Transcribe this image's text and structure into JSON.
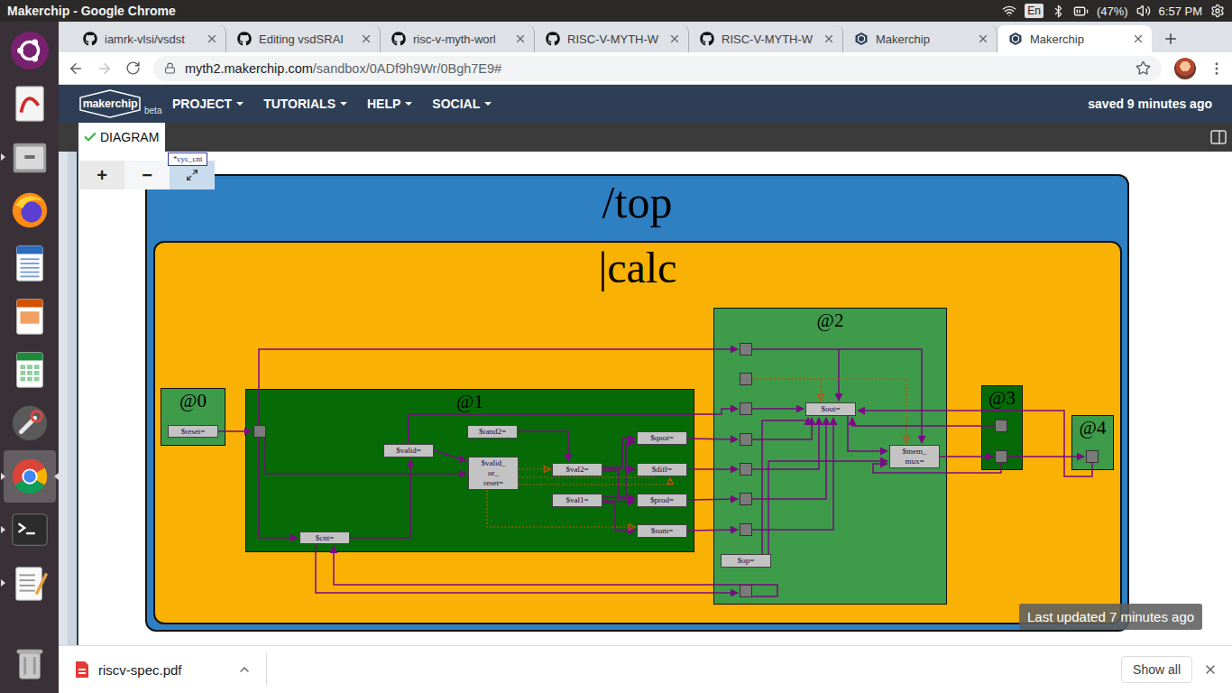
{
  "os_bar": {
    "title": "Makerchip - Google Chrome",
    "language": "En",
    "battery": "(47%)",
    "time": "6:57 PM"
  },
  "dock": [
    {
      "kind": "ubuntu",
      "running": false,
      "focused": false
    },
    {
      "kind": "reader",
      "running": false,
      "focused": false
    },
    {
      "kind": "files",
      "running": true,
      "focused": false
    },
    {
      "kind": "firefox",
      "running": false,
      "focused": false
    },
    {
      "kind": "writer",
      "running": false,
      "focused": false
    },
    {
      "kind": "impress",
      "running": false,
      "focused": false
    },
    {
      "kind": "calc",
      "running": false,
      "focused": false
    },
    {
      "kind": "settings",
      "running": false,
      "focused": false
    },
    {
      "kind": "chrome",
      "running": true,
      "focused": true
    },
    {
      "kind": "terminal",
      "running": true,
      "focused": false
    },
    {
      "kind": "editor",
      "running": true,
      "focused": false
    },
    {
      "kind": "trash",
      "running": false,
      "focused": false
    }
  ],
  "browser": {
    "tabs": [
      {
        "label": "iamrk-vlsi/vsdst",
        "kind": "github",
        "selected": false
      },
      {
        "label": "Editing vsdSRAI",
        "kind": "github",
        "selected": false
      },
      {
        "label": "risc-v-myth-worl",
        "kind": "github",
        "selected": false
      },
      {
        "label": "RISC-V-MYTH-W",
        "kind": "github",
        "selected": false
      },
      {
        "label": "RISC-V-MYTH-W",
        "kind": "github",
        "selected": false
      },
      {
        "label": "Makerchip",
        "kind": "makerchip",
        "selected": false
      },
      {
        "label": "Makerchip",
        "kind": "makerchip",
        "selected": true
      }
    ],
    "url_host": "myth2.makerchip.com",
    "url_path": "/sandbox/0ADf9h9Wr/0Bgh7E9#"
  },
  "app": {
    "logo": "makerchip",
    "badge": "beta",
    "menu": [
      "PROJECT",
      "TUTORIALS",
      "HELP",
      "SOCIAL"
    ],
    "status": "saved 9 minutes ago",
    "panel_tab": {
      "label": "DIAGRAM",
      "checked": true
    },
    "zoom_in": "+",
    "zoom_out": "−",
    "tooltip": "*cyc_cnt",
    "overlay": "Last updated 7 minutes ago"
  },
  "diagram": {
    "scope": "/top",
    "pipeline": "|calc",
    "stages": [
      {
        "label": "@0",
        "color": "#3e9b4a"
      },
      {
        "label": "@1",
        "color": "#066b06"
      },
      {
        "label": "@2",
        "color": "#3e9b4a"
      },
      {
        "label": "@3",
        "color": "#066b06"
      },
      {
        "label": "@4",
        "color": "#3e9b4a"
      }
    ],
    "nodes": [
      "$reset=",
      "$valid=",
      "$rand2=",
      "$valid_ or_ reset=",
      "$quot=",
      "$val2=",
      "$diff=",
      "$val1=",
      "$prod=",
      "$sum=",
      "$cnt=",
      "$out=",
      "$mem_ mux=",
      "$op="
    ]
  },
  "downloads": {
    "file": "riscv-spec.pdf",
    "show_all": "Show all"
  }
}
